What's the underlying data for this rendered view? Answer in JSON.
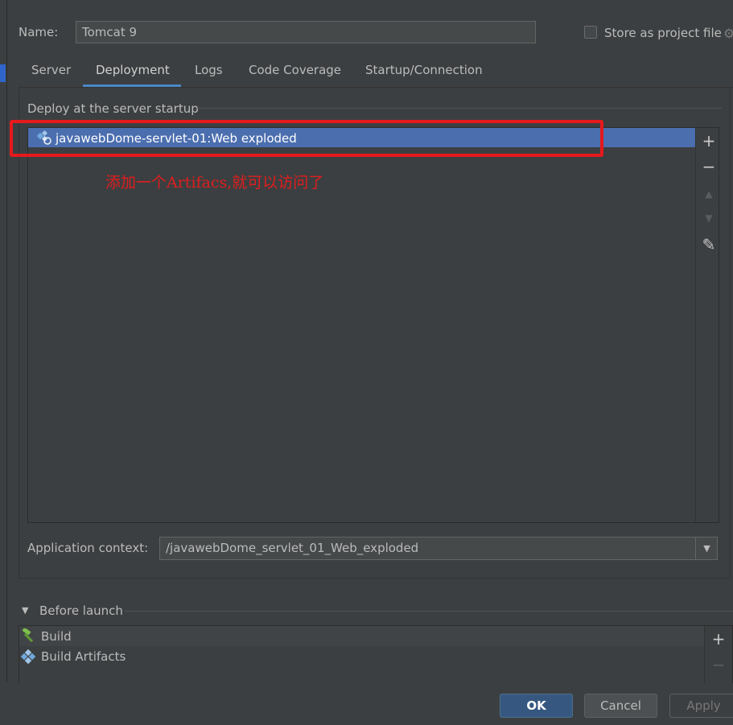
{
  "header": {
    "name_label": "Name:",
    "name_value": "Tomcat 9",
    "store_as_project_file_label": "Store as project file",
    "store_as_project_file_checked": false
  },
  "tabs": [
    {
      "label": "Server",
      "active": false
    },
    {
      "label": "Deployment",
      "active": true
    },
    {
      "label": "Logs",
      "active": false
    },
    {
      "label": "Code Coverage",
      "active": false
    },
    {
      "label": "Startup/Connection",
      "active": false
    }
  ],
  "deploy": {
    "section_label": "Deploy at the server startup",
    "items": [
      {
        "label": "javawebDome-servlet-01:Web exploded",
        "icon": "artifact-icon",
        "selected": true
      }
    ],
    "toolbar": {
      "add": "+",
      "remove": "−",
      "move_up": "▲",
      "move_down": "▼",
      "edit": "✎"
    }
  },
  "annotation": {
    "text": "添加一个Artifacs,就可以访问了",
    "color": "#e11d1d"
  },
  "app_context": {
    "label": "Application context:",
    "value": "/javawebDome_servlet_01_Web_exploded"
  },
  "before_launch": {
    "label": "Before launch",
    "items": [
      {
        "label": "Build",
        "icon": "hammer-icon"
      },
      {
        "label": "Build Artifacts",
        "icon": "artifact-icon"
      }
    ],
    "toolbar": {
      "add": "+",
      "remove": "−"
    }
  },
  "buttons": {
    "ok": "OK",
    "cancel": "Cancel",
    "apply": "Apply"
  },
  "colors": {
    "background": "#3c3f41",
    "selection": "#4b6eaf",
    "tab_underline": "#4a88c7",
    "highlight_border": "#e6191c",
    "ok_button": "#365880"
  }
}
